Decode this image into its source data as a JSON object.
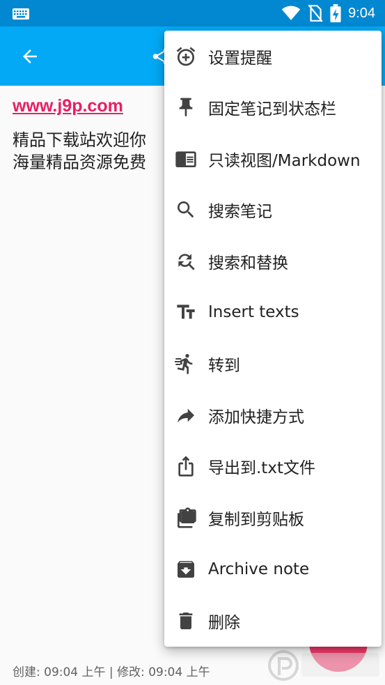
{
  "status_bar": {
    "time": "9:04"
  },
  "content": {
    "link": "www.j9p.com",
    "body_line1": "精品下载站欢迎你",
    "body_line2": "海量精品资源免费"
  },
  "footer": {
    "text": "创建: 09:04 上午 | 修改: 09:04 上午"
  },
  "menu": {
    "items": [
      {
        "label": "设置提醒",
        "icon": "alarm-add-icon"
      },
      {
        "label": "固定笔记到状态栏",
        "icon": "pin-icon"
      },
      {
        "label": "只读视图/Markdown",
        "icon": "reader-icon"
      },
      {
        "label": "搜索笔记",
        "icon": "search-icon"
      },
      {
        "label": "搜索和替换",
        "icon": "find-replace-icon"
      },
      {
        "label": "Insert texts",
        "icon": "text-fields-icon"
      },
      {
        "label": "转到",
        "icon": "run-icon"
      },
      {
        "label": "添加快捷方式",
        "icon": "forward-arrow-icon"
      },
      {
        "label": "导出到.txt文件",
        "icon": "export-icon"
      },
      {
        "label": "复制到剪贴板",
        "icon": "copy-icon"
      },
      {
        "label": "Archive note",
        "icon": "archive-icon"
      },
      {
        "label": "删除",
        "icon": "delete-icon"
      }
    ]
  },
  "colors": {
    "status_bar": "#0288d1",
    "app_bar": "#03a9f4",
    "link": "#e91e63",
    "fab": "#f23b6b"
  }
}
